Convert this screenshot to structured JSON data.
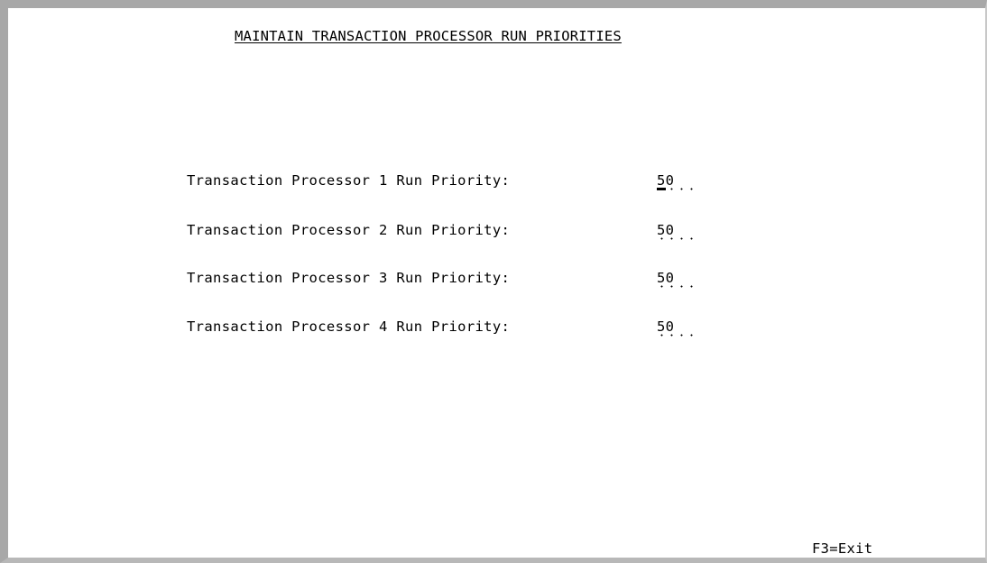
{
  "screen": {
    "title": "MAINTAIN TRANSACTION PROCESSOR RUN PRIORITIES"
  },
  "fields": [
    {
      "label": "Transaction Processor 1 Run Priority:",
      "value": "50"
    },
    {
      "label": "Transaction Processor 2 Run Priority:",
      "value": "50"
    },
    {
      "label": "Transaction Processor 3 Run Priority:",
      "value": "50"
    },
    {
      "label": "Transaction Processor 4 Run Priority:",
      "value": "50"
    }
  ],
  "function_keys": {
    "exit": "F3=Exit"
  }
}
